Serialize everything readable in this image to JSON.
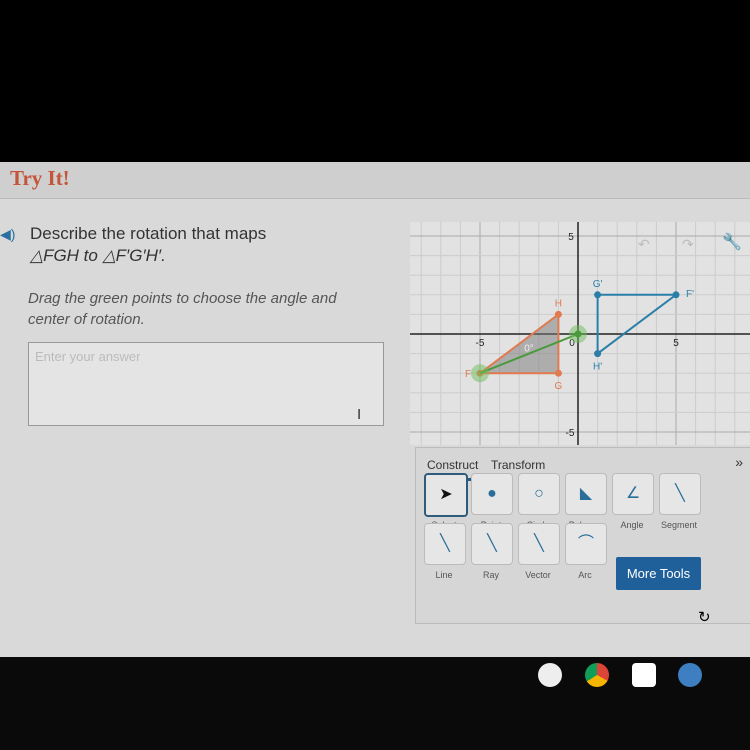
{
  "header": {
    "title": "Try It!"
  },
  "question": {
    "line1": "Describe the rotation that maps",
    "line2": "△FGH to △F′G′H′.",
    "instructions": "Drag the green points to choose the angle and center of rotation."
  },
  "answer": {
    "placeholder": "Enter your answer",
    "value": ""
  },
  "graph": {
    "axis_labels": {
      "x_neg": "-5",
      "x_zero": "0",
      "x_pos": "5",
      "y_pos": "5",
      "y_neg": "-5"
    },
    "angle_label": "0°",
    "original": {
      "color": "#e07a4f",
      "points": [
        {
          "label": "F",
          "x": -5,
          "y": -2
        },
        {
          "label": "G",
          "x": -1,
          "y": -2
        },
        {
          "label": "H",
          "x": -1,
          "y": 1
        }
      ]
    },
    "image": {
      "color": "#2a7fa8",
      "points": [
        {
          "label": "F'",
          "x": 5,
          "y": 2
        },
        {
          "label": "G'",
          "x": 1,
          "y": 2
        },
        {
          "label": "H'",
          "x": 1,
          "y": -1
        }
      ]
    },
    "rotation_center": {
      "x": 0,
      "y": 0,
      "color": "#4a9a3c"
    }
  },
  "toolbar": {
    "tabs": [
      "Construct",
      "Transform"
    ],
    "tools": [
      "Select",
      "Point",
      "Circle",
      "Polygon",
      "Angle",
      "Segment",
      "Line",
      "Ray",
      "Vector",
      "Arc"
    ],
    "more_tools": "More Tools"
  }
}
